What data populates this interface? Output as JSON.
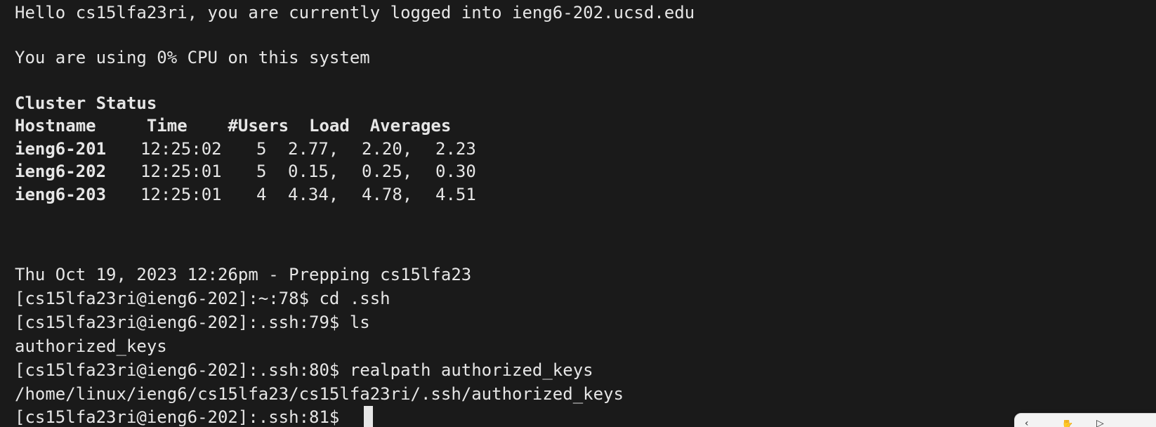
{
  "terminal": {
    "greeting": "Hello cs15lfa23ri, you are currently logged into ieng6-202.ucsd.edu",
    "cpu_usage": "You are using 0% CPU on this system",
    "cluster_title": "Cluster Status",
    "cluster_header": "Hostname     Time    #Users  Load  Averages",
    "cluster_rows": [
      {
        "host": "ieng6-201",
        "time": "12:25:02",
        "users": "5",
        "load1": "2.77,",
        "load5": "2.20,",
        "load15": "2.23"
      },
      {
        "host": "ieng6-202",
        "time": "12:25:01",
        "users": "5",
        "load1": "0.15,",
        "load5": "0.25,",
        "load15": "0.30"
      },
      {
        "host": "ieng6-203",
        "time": "12:25:01",
        "users": "4",
        "load1": "4.34,",
        "load5": "4.78,",
        "load15": "4.51"
      }
    ],
    "prep_line": "Thu Oct 19, 2023 12:26pm - Prepping cs15lfa23",
    "history": [
      "[cs15lfa23ri@ieng6-202]:~:78$ cd .ssh",
      "[cs15lfa23ri@ieng6-202]:.ssh:79$ ls",
      "authorized_keys",
      "[cs15lfa23ri@ieng6-202]:.ssh:80$ realpath authorized_keys",
      "/home/linux/ieng6/cs15lfa23/cs15lfa23ri/.ssh/authorized_keys"
    ],
    "current_prompt": "[cs15lfa23ri@ieng6-202]:.ssh:81$ "
  },
  "colors": {
    "background": "#1a1a1a",
    "foreground": "#e6e6e6"
  },
  "toolbar": {
    "icons": [
      "chevron-icon",
      "hand-icon",
      "play-icon"
    ]
  }
}
